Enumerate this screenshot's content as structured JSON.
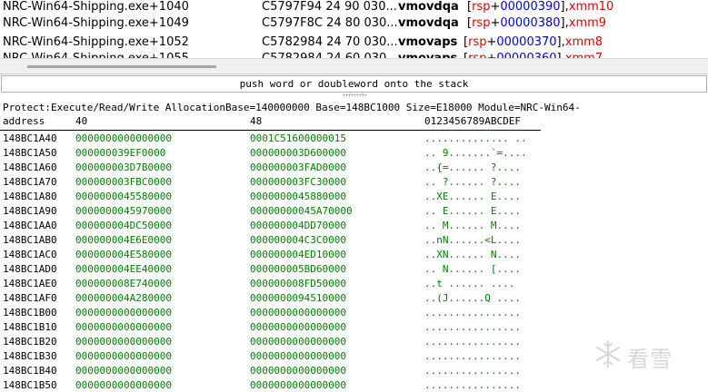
{
  "disasm": {
    "rows": [
      {
        "addr": "NRC-Win64-Shipping.exe+1040",
        "bytes": "C5797F94 24 90 030...",
        "mnemonic": "vmovdqa",
        "ops_pre": "[",
        "ops_reg": "rsp",
        "ops_plus": "+",
        "ops_num": "00000390",
        "ops_mid": "],",
        "ops_tail": "xmm10"
      },
      {
        "addr": "NRC-Win64-Shipping.exe+1049",
        "bytes": "C5797F8C 24 80 030...",
        "mnemonic": "vmovdqa",
        "ops_pre": "[",
        "ops_reg": "rsp",
        "ops_plus": "+",
        "ops_num": "00000380",
        "ops_mid": "],",
        "ops_tail": "xmm9"
      },
      {
        "addr": "NRC-Win64-Shipping.exe+1052",
        "bytes": "C5782984 24 70 030...",
        "mnemonic": "vmovaps",
        "ops_pre": "[",
        "ops_reg": "rsp",
        "ops_plus": "+",
        "ops_num": "00000370",
        "ops_mid": "],",
        "ops_tail": "xmm8"
      },
      {
        "addr": "NRC-Win64-Shipping.exe+1055",
        "bytes": "C5782984 24 60 030...",
        "mnemonic": "vmovaps",
        "ops_pre": "[",
        "ops_reg": "rsp",
        "ops_plus": "+",
        "ops_num": "00000360",
        "ops_mid": "],",
        "ops_tail": "xmm7"
      }
    ]
  },
  "info_bar": {
    "text": "push word or doubleword onto the stack"
  },
  "dump": {
    "info_line": "Protect:Execute/Read/Write  AllocationBase=140000000 Base=148BC1000 Size=E18000 Module=NRC-Win64-",
    "header": {
      "address": "address",
      "col1": "40",
      "col2": "48",
      "ascii": "0123456789ABCDEF"
    },
    "rows": [
      {
        "addr": "148BC1A40",
        "q1": "0000000000000000",
        "q2": "0001C51600000015",
        "ascii": ".............. .."
      },
      {
        "addr": "148BC1A50",
        "q1": "000000039EF0000",
        "q2": "000000003D600000",
        "ascii": ".. 9.......`=...."
      },
      {
        "addr": "148BC1A60",
        "q1": "000000003D7B0000",
        "q2": "000000003FAD0000",
        "ascii": "..{=...... ?...."
      },
      {
        "addr": "148BC1A70",
        "q1": "000000003FBC0000",
        "q2": "000000003FC30000",
        "ascii": ".. ?...... ?...."
      },
      {
        "addr": "148BC1A80",
        "q1": "0000000045580000",
        "q2": "0000000045880000",
        "ascii": "..XE...... E...."
      },
      {
        "addr": "148BC1A90",
        "q1": "0000000045970000",
        "q2": "00000000045A70000",
        "ascii": ".. E...... E...."
      },
      {
        "addr": "148BC1AA0",
        "q1": "000000004DC50000",
        "q2": "000000004DD70000",
        "ascii": ".. M...... M...."
      },
      {
        "addr": "148BC1AB0",
        "q1": "000000004E6E0000",
        "q2": "000000004C3C0000",
        "ascii": "..nN......<L...."
      },
      {
        "addr": "148BC1AC0",
        "q1": "000000004E580000",
        "q2": "000000004ED10000",
        "ascii": "..XN...... N...."
      },
      {
        "addr": "148BC1AD0",
        "q1": "000000004EE40000",
        "q2": "000000005BD60000",
        "ascii": ".. N...... [...."
      },
      {
        "addr": "148BC1AE0",
        "q1": "000000008E740000",
        "q2": "000000008FD50000",
        "ascii": "..t ...... ...."
      },
      {
        "addr": "148BC1AF0",
        "q1": "000000004A280000",
        "q2": "0000000094510000",
        "ascii": "..(J......Q ...."
      },
      {
        "addr": "148BC1B00",
        "q1": "0000000000000000",
        "q2": "0000000000000000",
        "ascii": "................"
      },
      {
        "addr": "148BC1B10",
        "q1": "0000000000000000",
        "q2": "0000000000000000",
        "ascii": "................"
      },
      {
        "addr": "148BC1B20",
        "q1": "0000000000000000",
        "q2": "0000000000000000",
        "ascii": "................"
      },
      {
        "addr": "148BC1B30",
        "q1": "0000000000000000",
        "q2": "0000000000000000",
        "ascii": "................"
      },
      {
        "addr": "148BC1B40",
        "q1": "0000000000000000",
        "q2": "0000000000000000",
        "ascii": "................"
      },
      {
        "addr": "148BC1B50",
        "q1": "0000000000000000",
        "q2": "0000000000000000",
        "ascii": "................"
      }
    ]
  },
  "watermark": {
    "icon": "snowflake-icon",
    "text": "看雪"
  }
}
